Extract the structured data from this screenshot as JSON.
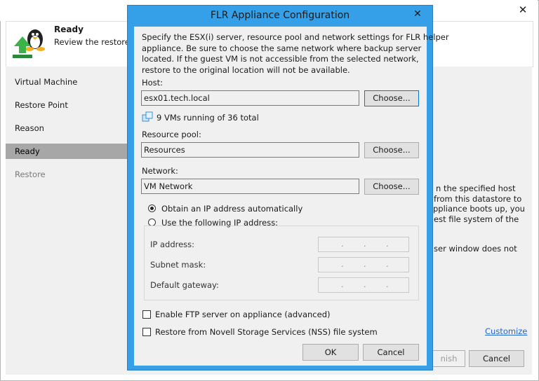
{
  "background_window": {
    "header": {
      "title": "Ready",
      "subtitle": "Review the restore s"
    },
    "nav": [
      {
        "label": "Virtual Machine",
        "state": "normal"
      },
      {
        "label": "Restore Point",
        "state": "normal"
      },
      {
        "label": "Reason",
        "state": "normal"
      },
      {
        "label": "Ready",
        "state": "active"
      },
      {
        "label": "Restore",
        "state": "disabled"
      }
    ],
    "body_lines": [
      "n the specified host",
      "from this datastore to",
      "ppliance boots up, you",
      "est file system of the",
      "ser window does not"
    ],
    "customize_link": "Customize",
    "finish_button": "nish",
    "cancel_button": "Cancel"
  },
  "dialog": {
    "title": "FLR Appliance Configuration",
    "description": [
      "Specify the ESX(i) server, resource pool and network settings for FLR helper",
      "appliance. Be sure to choose the same network where backup server",
      "located. If the guest VM is not accessible from the selected network,",
      "restore to the original location will not be available."
    ],
    "host": {
      "label": "Host:",
      "value": "esx01.tech.local",
      "choose": "Choose..."
    },
    "host_status": "9 VMs running of 36 total",
    "resource_pool": {
      "label": "Resource pool:",
      "value": "Resources",
      "choose": "Choose..."
    },
    "network": {
      "label": "Network:",
      "value": "VM Network",
      "choose": "Choose..."
    },
    "ip_mode": {
      "auto_label": "Obtain an IP address automatically",
      "manual_label": "Use the following IP address:",
      "selected": "auto"
    },
    "ip_fields": [
      {
        "label": "IP address:"
      },
      {
        "label": "Subnet mask:"
      },
      {
        "label": "Default gateway:"
      }
    ],
    "ftp_label": "Enable FTP server on appliance (advanced)",
    "nss_label": "Restore from Novell Storage Services (NSS) file system",
    "ok": "OK",
    "cancel": "Cancel"
  },
  "colors": {
    "dialog_frame": "#35a0e8",
    "accent": "#0078d7",
    "link": "#2266cc",
    "active_nav": "#a7a7a7"
  }
}
